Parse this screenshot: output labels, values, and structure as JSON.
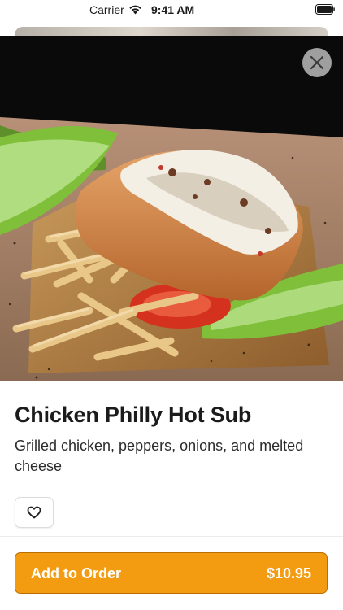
{
  "status_bar": {
    "carrier": "Carrier",
    "time": "9:41 AM",
    "wifi_icon": "wifi-icon",
    "battery_icon": "battery-icon"
  },
  "item": {
    "title": "Chicken Philly Hot Sub",
    "description": "Grilled chicken, peppers, onions, and melted cheese",
    "price": "$10.95"
  },
  "actions": {
    "close_icon": "close-icon",
    "favorite_icon": "heart-icon",
    "add_label": "Add to Order"
  },
  "colors": {
    "accent": "#f39c12",
    "accent_border": "#b86f00",
    "text": "#1b1b1b"
  }
}
